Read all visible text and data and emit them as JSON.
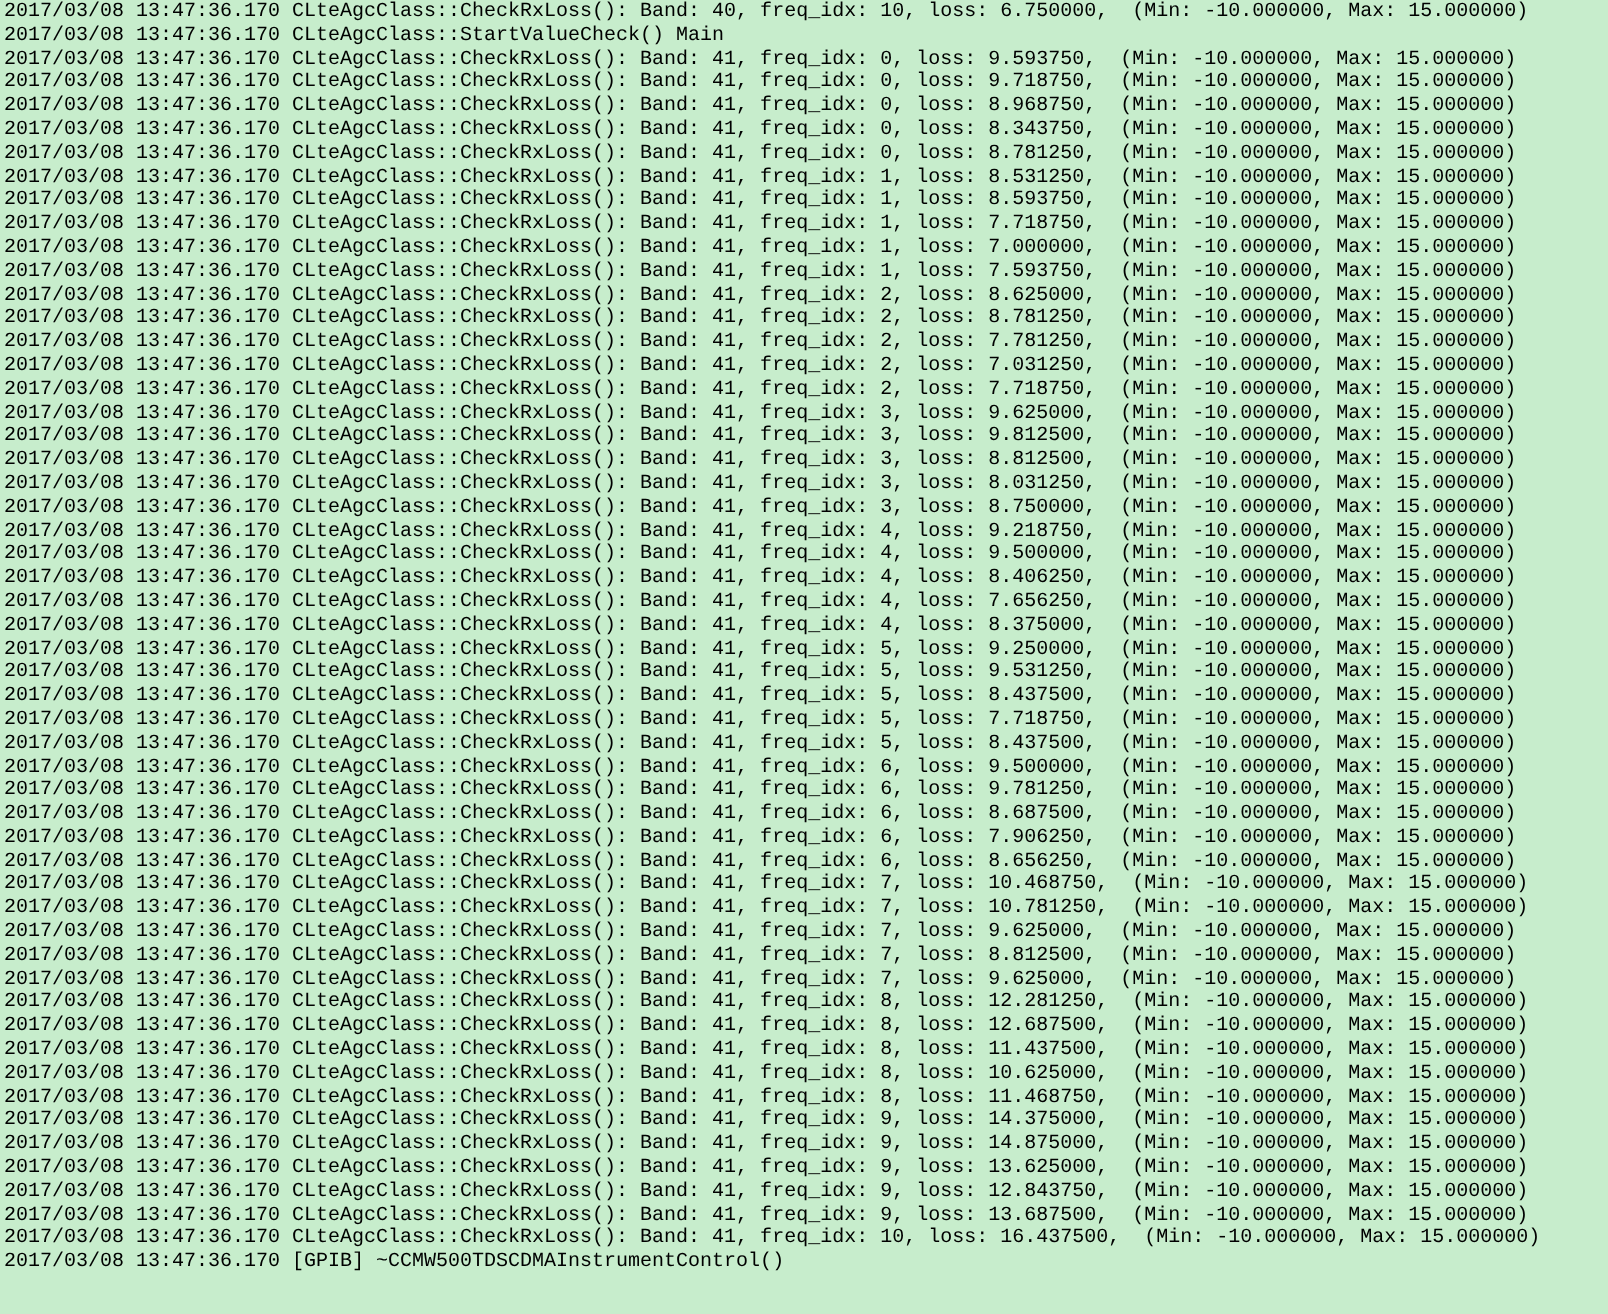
{
  "log_lines": [
    "2017/03/08 13:47:36.170 CLteAgcClass::CheckRxLoss(): Band: 40, freq_idx: 10, loss: 6.750000,  (Min: -10.000000, Max: 15.000000)",
    "2017/03/08 13:47:36.170 CLteAgcClass::StartValueCheck() Main",
    "2017/03/08 13:47:36.170 CLteAgcClass::CheckRxLoss(): Band: 41, freq_idx: 0, loss: 9.593750,  (Min: -10.000000, Max: 15.000000)",
    "2017/03/08 13:47:36.170 CLteAgcClass::CheckRxLoss(): Band: 41, freq_idx: 0, loss: 9.718750,  (Min: -10.000000, Max: 15.000000)",
    "2017/03/08 13:47:36.170 CLteAgcClass::CheckRxLoss(): Band: 41, freq_idx: 0, loss: 8.968750,  (Min: -10.000000, Max: 15.000000)",
    "2017/03/08 13:47:36.170 CLteAgcClass::CheckRxLoss(): Band: 41, freq_idx: 0, loss: 8.343750,  (Min: -10.000000, Max: 15.000000)",
    "2017/03/08 13:47:36.170 CLteAgcClass::CheckRxLoss(): Band: 41, freq_idx: 0, loss: 8.781250,  (Min: -10.000000, Max: 15.000000)",
    "2017/03/08 13:47:36.170 CLteAgcClass::CheckRxLoss(): Band: 41, freq_idx: 1, loss: 8.531250,  (Min: -10.000000, Max: 15.000000)",
    "2017/03/08 13:47:36.170 CLteAgcClass::CheckRxLoss(): Band: 41, freq_idx: 1, loss: 8.593750,  (Min: -10.000000, Max: 15.000000)",
    "2017/03/08 13:47:36.170 CLteAgcClass::CheckRxLoss(): Band: 41, freq_idx: 1, loss: 7.718750,  (Min: -10.000000, Max: 15.000000)",
    "2017/03/08 13:47:36.170 CLteAgcClass::CheckRxLoss(): Band: 41, freq_idx: 1, loss: 7.000000,  (Min: -10.000000, Max: 15.000000)",
    "2017/03/08 13:47:36.170 CLteAgcClass::CheckRxLoss(): Band: 41, freq_idx: 1, loss: 7.593750,  (Min: -10.000000, Max: 15.000000)",
    "2017/03/08 13:47:36.170 CLteAgcClass::CheckRxLoss(): Band: 41, freq_idx: 2, loss: 8.625000,  (Min: -10.000000, Max: 15.000000)",
    "2017/03/08 13:47:36.170 CLteAgcClass::CheckRxLoss(): Band: 41, freq_idx: 2, loss: 8.781250,  (Min: -10.000000, Max: 15.000000)",
    "2017/03/08 13:47:36.170 CLteAgcClass::CheckRxLoss(): Band: 41, freq_idx: 2, loss: 7.781250,  (Min: -10.000000, Max: 15.000000)",
    "2017/03/08 13:47:36.170 CLteAgcClass::CheckRxLoss(): Band: 41, freq_idx: 2, loss: 7.031250,  (Min: -10.000000, Max: 15.000000)",
    "2017/03/08 13:47:36.170 CLteAgcClass::CheckRxLoss(): Band: 41, freq_idx: 2, loss: 7.718750,  (Min: -10.000000, Max: 15.000000)",
    "2017/03/08 13:47:36.170 CLteAgcClass::CheckRxLoss(): Band: 41, freq_idx: 3, loss: 9.625000,  (Min: -10.000000, Max: 15.000000)",
    "2017/03/08 13:47:36.170 CLteAgcClass::CheckRxLoss(): Band: 41, freq_idx: 3, loss: 9.812500,  (Min: -10.000000, Max: 15.000000)",
    "2017/03/08 13:47:36.170 CLteAgcClass::CheckRxLoss(): Band: 41, freq_idx: 3, loss: 8.812500,  (Min: -10.000000, Max: 15.000000)",
    "2017/03/08 13:47:36.170 CLteAgcClass::CheckRxLoss(): Band: 41, freq_idx: 3, loss: 8.031250,  (Min: -10.000000, Max: 15.000000)",
    "2017/03/08 13:47:36.170 CLteAgcClass::CheckRxLoss(): Band: 41, freq_idx: 3, loss: 8.750000,  (Min: -10.000000, Max: 15.000000)",
    "2017/03/08 13:47:36.170 CLteAgcClass::CheckRxLoss(): Band: 41, freq_idx: 4, loss: 9.218750,  (Min: -10.000000, Max: 15.000000)",
    "2017/03/08 13:47:36.170 CLteAgcClass::CheckRxLoss(): Band: 41, freq_idx: 4, loss: 9.500000,  (Min: -10.000000, Max: 15.000000)",
    "2017/03/08 13:47:36.170 CLteAgcClass::CheckRxLoss(): Band: 41, freq_idx: 4, loss: 8.406250,  (Min: -10.000000, Max: 15.000000)",
    "2017/03/08 13:47:36.170 CLteAgcClass::CheckRxLoss(): Band: 41, freq_idx: 4, loss: 7.656250,  (Min: -10.000000, Max: 15.000000)",
    "2017/03/08 13:47:36.170 CLteAgcClass::CheckRxLoss(): Band: 41, freq_idx: 4, loss: 8.375000,  (Min: -10.000000, Max: 15.000000)",
    "2017/03/08 13:47:36.170 CLteAgcClass::CheckRxLoss(): Band: 41, freq_idx: 5, loss: 9.250000,  (Min: -10.000000, Max: 15.000000)",
    "2017/03/08 13:47:36.170 CLteAgcClass::CheckRxLoss(): Band: 41, freq_idx: 5, loss: 9.531250,  (Min: -10.000000, Max: 15.000000)",
    "2017/03/08 13:47:36.170 CLteAgcClass::CheckRxLoss(): Band: 41, freq_idx: 5, loss: 8.437500,  (Min: -10.000000, Max: 15.000000)",
    "2017/03/08 13:47:36.170 CLteAgcClass::CheckRxLoss(): Band: 41, freq_idx: 5, loss: 7.718750,  (Min: -10.000000, Max: 15.000000)",
    "2017/03/08 13:47:36.170 CLteAgcClass::CheckRxLoss(): Band: 41, freq_idx: 5, loss: 8.437500,  (Min: -10.000000, Max: 15.000000)",
    "2017/03/08 13:47:36.170 CLteAgcClass::CheckRxLoss(): Band: 41, freq_idx: 6, loss: 9.500000,  (Min: -10.000000, Max: 15.000000)",
    "2017/03/08 13:47:36.170 CLteAgcClass::CheckRxLoss(): Band: 41, freq_idx: 6, loss: 9.781250,  (Min: -10.000000, Max: 15.000000)",
    "2017/03/08 13:47:36.170 CLteAgcClass::CheckRxLoss(): Band: 41, freq_idx: 6, loss: 8.687500,  (Min: -10.000000, Max: 15.000000)",
    "2017/03/08 13:47:36.170 CLteAgcClass::CheckRxLoss(): Band: 41, freq_idx: 6, loss: 7.906250,  (Min: -10.000000, Max: 15.000000)",
    "2017/03/08 13:47:36.170 CLteAgcClass::CheckRxLoss(): Band: 41, freq_idx: 6, loss: 8.656250,  (Min: -10.000000, Max: 15.000000)",
    "2017/03/08 13:47:36.170 CLteAgcClass::CheckRxLoss(): Band: 41, freq_idx: 7, loss: 10.468750,  (Min: -10.000000, Max: 15.000000)",
    "2017/03/08 13:47:36.170 CLteAgcClass::CheckRxLoss(): Band: 41, freq_idx: 7, loss: 10.781250,  (Min: -10.000000, Max: 15.000000)",
    "2017/03/08 13:47:36.170 CLteAgcClass::CheckRxLoss(): Band: 41, freq_idx: 7, loss: 9.625000,  (Min: -10.000000, Max: 15.000000)",
    "2017/03/08 13:47:36.170 CLteAgcClass::CheckRxLoss(): Band: 41, freq_idx: 7, loss: 8.812500,  (Min: -10.000000, Max: 15.000000)",
    "2017/03/08 13:47:36.170 CLteAgcClass::CheckRxLoss(): Band: 41, freq_idx: 7, loss: 9.625000,  (Min: -10.000000, Max: 15.000000)",
    "2017/03/08 13:47:36.170 CLteAgcClass::CheckRxLoss(): Band: 41, freq_idx: 8, loss: 12.281250,  (Min: -10.000000, Max: 15.000000)",
    "2017/03/08 13:47:36.170 CLteAgcClass::CheckRxLoss(): Band: 41, freq_idx: 8, loss: 12.687500,  (Min: -10.000000, Max: 15.000000)",
    "2017/03/08 13:47:36.170 CLteAgcClass::CheckRxLoss(): Band: 41, freq_idx: 8, loss: 11.437500,  (Min: -10.000000, Max: 15.000000)",
    "2017/03/08 13:47:36.170 CLteAgcClass::CheckRxLoss(): Band: 41, freq_idx: 8, loss: 10.625000,  (Min: -10.000000, Max: 15.000000)",
    "2017/03/08 13:47:36.170 CLteAgcClass::CheckRxLoss(): Band: 41, freq_idx: 8, loss: 11.468750,  (Min: -10.000000, Max: 15.000000)",
    "2017/03/08 13:47:36.170 CLteAgcClass::CheckRxLoss(): Band: 41, freq_idx: 9, loss: 14.375000,  (Min: -10.000000, Max: 15.000000)",
    "2017/03/08 13:47:36.170 CLteAgcClass::CheckRxLoss(): Band: 41, freq_idx: 9, loss: 14.875000,  (Min: -10.000000, Max: 15.000000)",
    "2017/03/08 13:47:36.170 CLteAgcClass::CheckRxLoss(): Band: 41, freq_idx: 9, loss: 13.625000,  (Min: -10.000000, Max: 15.000000)",
    "2017/03/08 13:47:36.170 CLteAgcClass::CheckRxLoss(): Band: 41, freq_idx: 9, loss: 12.843750,  (Min: -10.000000, Max: 15.000000)",
    "2017/03/08 13:47:36.170 CLteAgcClass::CheckRxLoss(): Band: 41, freq_idx: 9, loss: 13.687500,  (Min: -10.000000, Max: 15.000000)",
    "2017/03/08 13:47:36.170 CLteAgcClass::CheckRxLoss(): Band: 41, freq_idx: 10, loss: 16.437500,  (Min: -10.000000, Max: 15.000000)",
    "2017/03/08 13:47:36.170 [GPIB] ~CCMW500TDSCDMAInstrumentControl()"
  ]
}
